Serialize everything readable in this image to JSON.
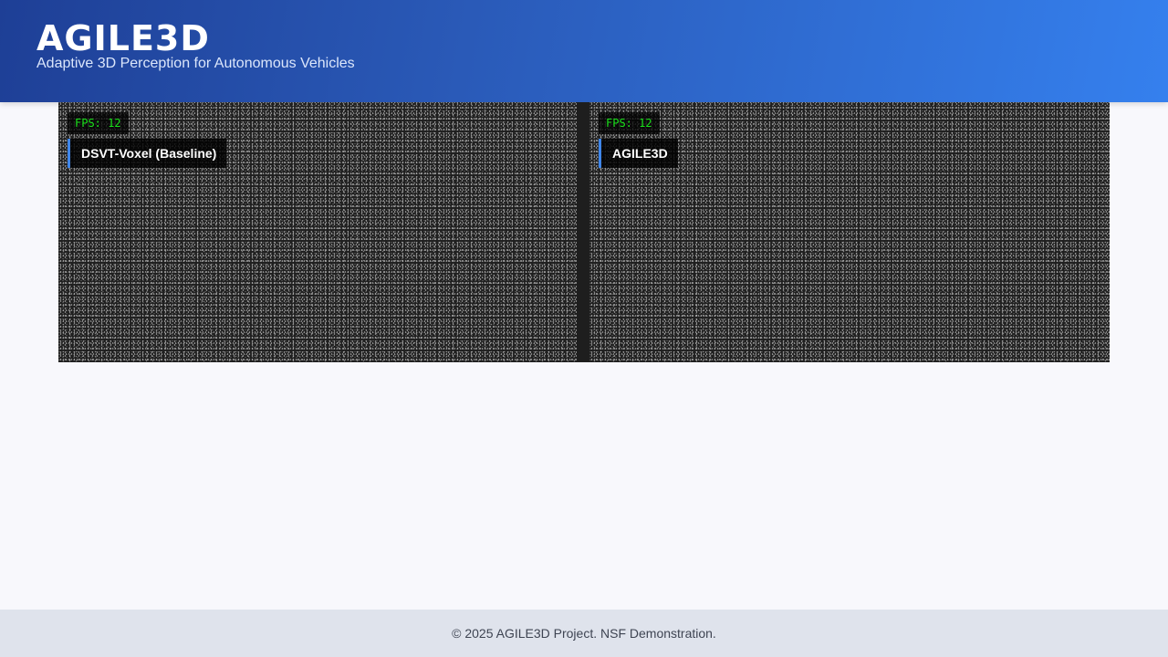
{
  "header": {
    "title": "AGILE3D",
    "subtitle": "Adaptive 3D Perception for Autonomous Vehicles"
  },
  "viewers": [
    {
      "fps": "FPS: 12",
      "model_label": "DSVT-Voxel (Baseline)"
    },
    {
      "fps": "FPS: 12",
      "model_label": "AGILE3D"
    }
  ],
  "footer": {
    "text": "© 2025 AGILE3D Project. NSF Demonstration."
  },
  "colors": {
    "header_gradient_start": "#1e3f96",
    "header_gradient_end": "#3580ee",
    "fps_text": "#19e119",
    "label_accent": "#3f86ea",
    "viewer_background": "#1f1f1f",
    "page_background": "#f8f8fc",
    "footer_background": "#dfe3ec"
  }
}
